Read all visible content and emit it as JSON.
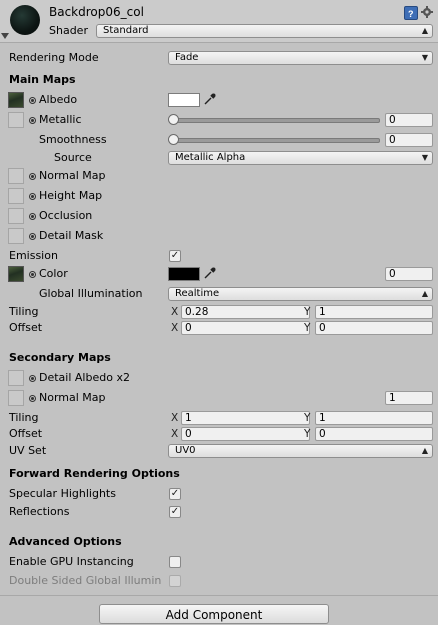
{
  "header": {
    "material_name": "Backdrop06_col",
    "shader_label": "Shader",
    "shader_value": "Standard"
  },
  "rendering_mode": {
    "label": "Rendering Mode",
    "value": "Fade"
  },
  "main_maps": {
    "title": "Main Maps",
    "albedo": "Albedo",
    "albedo_color": "#ffffff",
    "metallic": {
      "label": "Metallic",
      "value": "0"
    },
    "smoothness": {
      "label": "Smoothness",
      "value": "0"
    },
    "source": {
      "label": "Source",
      "value": "Metallic Alpha"
    },
    "normal_map": "Normal Map",
    "height_map": "Height Map",
    "occlusion": "Occlusion",
    "detail_mask": "Detail Mask",
    "emission": {
      "label": "Emission",
      "checked": true
    },
    "emission_color": {
      "label": "Color",
      "color": "#000000",
      "value": "0"
    },
    "global_illumination": {
      "label": "Global Illumination",
      "value": "Realtime"
    },
    "tiling": {
      "label": "Tiling",
      "x": "0.28",
      "y": "1"
    },
    "offset": {
      "label": "Offset",
      "x": "0",
      "y": "0"
    }
  },
  "secondary_maps": {
    "title": "Secondary Maps",
    "detail_albedo": "Detail Albedo x2",
    "normal_map": {
      "label": "Normal Map",
      "value": "1"
    },
    "tiling": {
      "label": "Tiling",
      "x": "1",
      "y": "1"
    },
    "offset": {
      "label": "Offset",
      "x": "0",
      "y": "0"
    },
    "uv_set": {
      "label": "UV Set",
      "value": "UV0"
    }
  },
  "forward_rendering": {
    "title": "Forward Rendering Options",
    "specular_highlights": {
      "label": "Specular Highlights",
      "checked": true
    },
    "reflections": {
      "label": "Reflections",
      "checked": true
    }
  },
  "advanced": {
    "title": "Advanced Options",
    "gpu_instancing": {
      "label": "Enable GPU Instancing",
      "checked": false
    },
    "double_sided": {
      "label": "Double Sided Global Illumin",
      "checked": false
    }
  },
  "axis_labels": {
    "x": "X",
    "y": "Y"
  },
  "add_component": "Add Component",
  "icons": {
    "help": "help-book-icon",
    "settings": "gear-icon",
    "color_picker": "eyedropper-icon"
  }
}
